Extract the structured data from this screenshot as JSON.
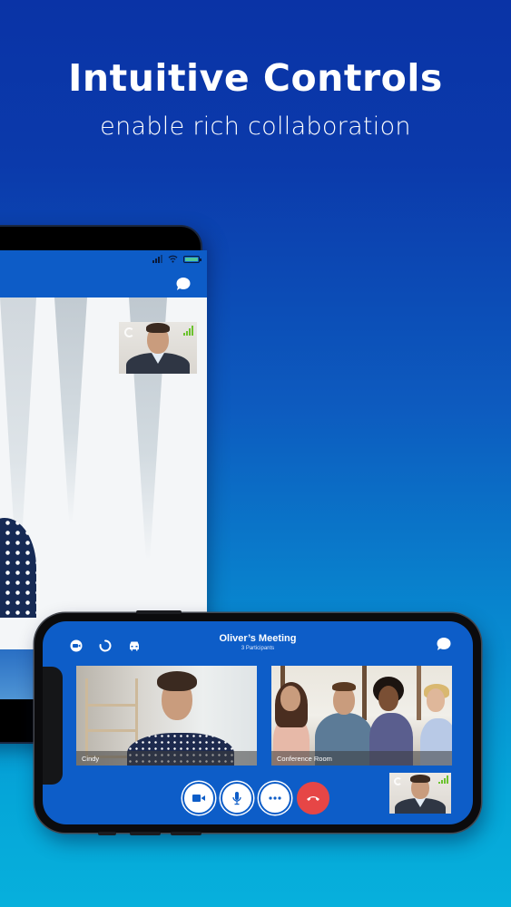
{
  "hero": {
    "title": "Intuitive Controls",
    "subtitle": "enable rich collaboration"
  },
  "tablet": {
    "status_icons": [
      "cellular-signal-icon",
      "wifi-icon",
      "battery-icon"
    ],
    "chat_icon": "chat-bubble-icon",
    "self_view": {
      "icons": [
        "switch-camera-icon",
        "network-signal-icon"
      ]
    }
  },
  "phone": {
    "toolbar_icons": [
      "camera-toggle-icon",
      "loading-spinner-icon",
      "car-mode-icon"
    ],
    "meeting_title": "Oliver’s Meeting",
    "participants_label": "3 Participants",
    "chat_icon": "chat-bubble-icon",
    "tiles": [
      {
        "label": "Cindy"
      },
      {
        "label": "Conference Room"
      }
    ],
    "controls": [
      {
        "name": "video",
        "icon": "video-camera-icon"
      },
      {
        "name": "mute",
        "icon": "microphone-icon"
      },
      {
        "name": "more",
        "icon": "more-options-icon"
      },
      {
        "name": "end_call",
        "icon": "hang-up-icon"
      }
    ],
    "self_view": {
      "icons": [
        "switch-camera-icon",
        "network-signal-icon"
      ]
    }
  },
  "colors": {
    "brand_blue": "#0d5dc8",
    "end_call_red": "#e64646",
    "signal_green": "#6cc22e",
    "background_top": "#0a33a6",
    "background_bottom": "#07b0dc"
  }
}
